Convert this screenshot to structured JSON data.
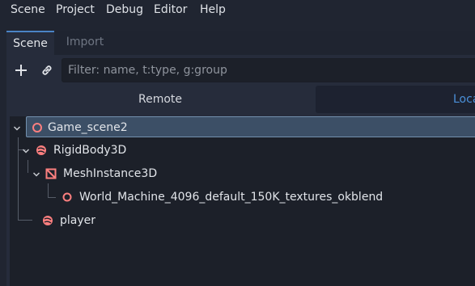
{
  "menu": {
    "items": [
      "Scene",
      "Project",
      "Debug",
      "Editor",
      "Help"
    ]
  },
  "tabs": {
    "scene": "Scene",
    "import": "Import"
  },
  "toolbar": {
    "add_icon": "plus-icon",
    "link_icon": "link-icon",
    "filter_placeholder": "Filter: name, t:type, g:group"
  },
  "segments": {
    "remote": "Remote",
    "local": "Loca"
  },
  "tree": {
    "nodes": [
      {
        "name": "Game_scene2",
        "icon": "node3d-icon"
      },
      {
        "name": "RigidBody3D",
        "icon": "rigidbody3d-icon"
      },
      {
        "name": "MeshInstance3D",
        "icon": "meshinstance3d-icon"
      },
      {
        "name": "World_Machine_4096_default_150K_textures_okblend",
        "icon": "node3d-icon"
      },
      {
        "name": "player",
        "icon": "rigidbody3d-icon"
      }
    ]
  },
  "colors": {
    "accent": "#4a90d9",
    "node_icon": "#fc7f7f",
    "background": "#202531"
  }
}
